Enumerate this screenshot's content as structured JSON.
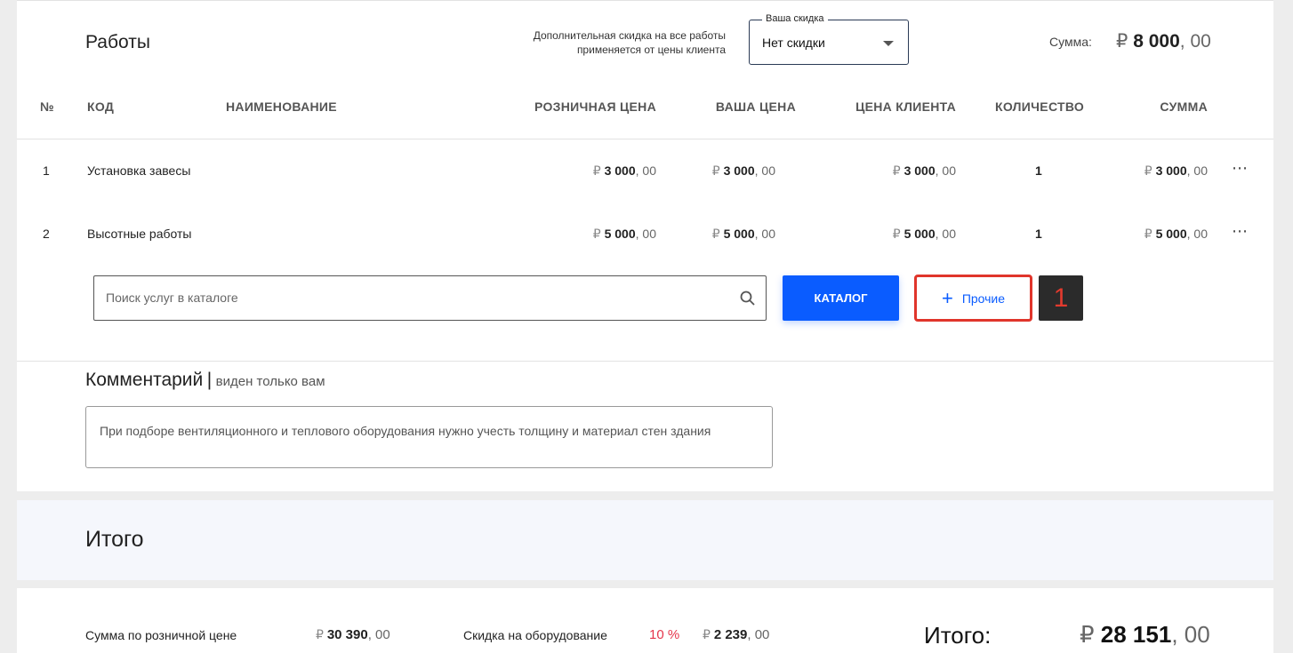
{
  "works": {
    "title": "Работы",
    "discount_note_line1": "Дополнительная скидка на все работы",
    "discount_note_line2": "применяется от цены клиента",
    "discount_select": {
      "legend": "Ваша скидка",
      "value": "Нет скидки"
    },
    "sum_label": "Сумма:",
    "sum_currency": "₽",
    "sum_main": "8 000",
    "sum_cents": ", 00"
  },
  "table": {
    "headers": {
      "num": "№",
      "code": "КОД",
      "name": "НАИМЕНОВАНИЕ",
      "retail": "РОЗНИЧНАЯ ЦЕНА",
      "your_price": "ВАША ЦЕНА",
      "client_price": "ЦЕНА КЛИЕНТА",
      "qty": "КОЛИЧЕСТВО",
      "sum": "СУММА"
    },
    "rows": [
      {
        "num": "1",
        "name": "Установка завесы",
        "cur": "₽",
        "retail": "3 000",
        "your_price": "3 000",
        "client_price": "3 000",
        "qty": "1",
        "sum": "3 000",
        "cents": ", 00",
        "menu": "⋯"
      },
      {
        "num": "2",
        "name": "Высотные работы",
        "cur": "₽",
        "retail": "5 000",
        "your_price": "5 000",
        "client_price": "5 000",
        "qty": "1",
        "sum": "5 000",
        "cents": ", 00",
        "menu": "⋯"
      }
    ]
  },
  "search": {
    "placeholder": "Поиск услуг в каталоге"
  },
  "buttons": {
    "catalog": "КАТАЛОГ",
    "other": "Прочие",
    "other_plus": "+"
  },
  "marker_badge": "1",
  "comment": {
    "title": "Комментарий",
    "separator": "|",
    "subtitle": "виден только вам",
    "text": "При подборе вентиляционного и теплового оборудования нужно учесть толщину и материал стен здания"
  },
  "totals": {
    "title": "Итого",
    "retail_sum_label": "Сумма по розничной цене",
    "retail_sum_cur": "₽",
    "retail_sum": "30 390",
    "retail_sum_cents": ", 00",
    "equip_discount_label": "Скидка на оборудование",
    "equip_discount_pct": "10 %",
    "equip_discount_cur": "₽",
    "equip_discount_value": "2 239",
    "equip_discount_cents": ", 00",
    "grand_label": "Итого:",
    "grand_cur": "₽",
    "grand_value": "28 151",
    "grand_cents": ", 00"
  },
  "colors": {
    "accent": "#0a5cff",
    "highlight_red": "#e0352b",
    "discount_pct": "#e5354b"
  }
}
